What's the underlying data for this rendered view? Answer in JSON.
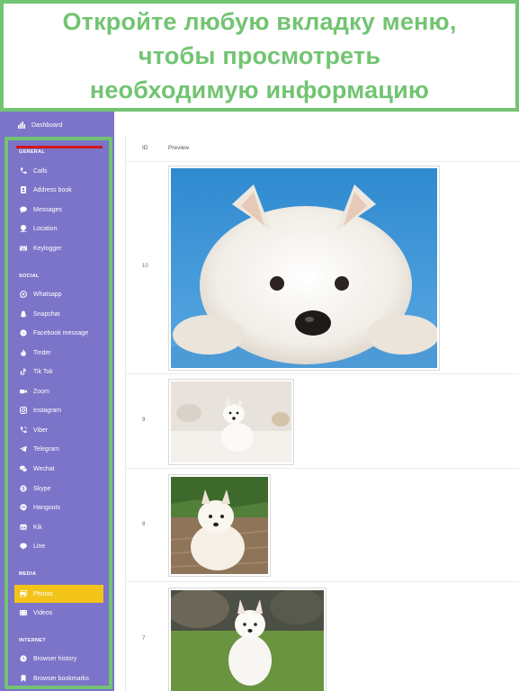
{
  "banner": {
    "lines": [
      "Откройте любую вкладку меню,",
      "чтобы просмотреть",
      "необходимую информацию"
    ]
  },
  "sidebar": {
    "dashboard": {
      "label": "Dashboard",
      "icon": "dashboard-icon"
    },
    "sections": {
      "general": "GENERAL",
      "social": "SOCIAL",
      "media": "MEDIA",
      "internet": "INTERNET"
    },
    "general_items": [
      {
        "label": "Calls",
        "icon": "phone-icon"
      },
      {
        "label": "Address book",
        "icon": "address-book-icon"
      },
      {
        "label": "Messages",
        "icon": "chat-icon"
      },
      {
        "label": "Location",
        "icon": "location-icon"
      },
      {
        "label": "Keylogger",
        "icon": "keyboard-icon"
      }
    ],
    "social_items": [
      {
        "label": "Whatsapp",
        "icon": "whatsapp-icon"
      },
      {
        "label": "Snapchat",
        "icon": "snapchat-icon"
      },
      {
        "label": "Facebook message",
        "icon": "messenger-icon"
      },
      {
        "label": "Tinder",
        "icon": "tinder-icon"
      },
      {
        "label": "Tik Tok",
        "icon": "tiktok-icon"
      },
      {
        "label": "Zoom",
        "icon": "zoom-icon"
      },
      {
        "label": "Instagram",
        "icon": "instagram-icon"
      },
      {
        "label": "Viber",
        "icon": "viber-icon"
      },
      {
        "label": "Telegram",
        "icon": "telegram-icon"
      },
      {
        "label": "Wechat",
        "icon": "wechat-icon"
      },
      {
        "label": "Skype",
        "icon": "skype-icon"
      },
      {
        "label": "Hangouts",
        "icon": "hangouts-icon"
      },
      {
        "label": "Kik",
        "icon": "kik-icon"
      },
      {
        "label": "Line",
        "icon": "line-icon"
      }
    ],
    "media_items": [
      {
        "label": "Photos",
        "icon": "photos-icon",
        "active": true
      },
      {
        "label": "Videos",
        "icon": "videos-icon"
      }
    ],
    "internet_items": [
      {
        "label": "Browser history",
        "icon": "browser-history-icon"
      },
      {
        "label": "Browser bookmarks",
        "icon": "bookmark-icon"
      }
    ]
  },
  "table": {
    "columns": [
      "ID",
      "Preview"
    ],
    "rows": [
      {
        "id": "10",
        "image": "westie-lying-blue-background"
      },
      {
        "id": "9",
        "image": "westie-sitting-on-rug"
      },
      {
        "id": "8",
        "image": "westie-sitting-on-path"
      },
      {
        "id": "7",
        "image": "westie-on-grass"
      }
    ]
  },
  "colors": {
    "accent_green": "#72c472",
    "sidebar_bg": "#7b74c8",
    "active_item": "#f2c41a",
    "red_bar": "#d11818"
  }
}
